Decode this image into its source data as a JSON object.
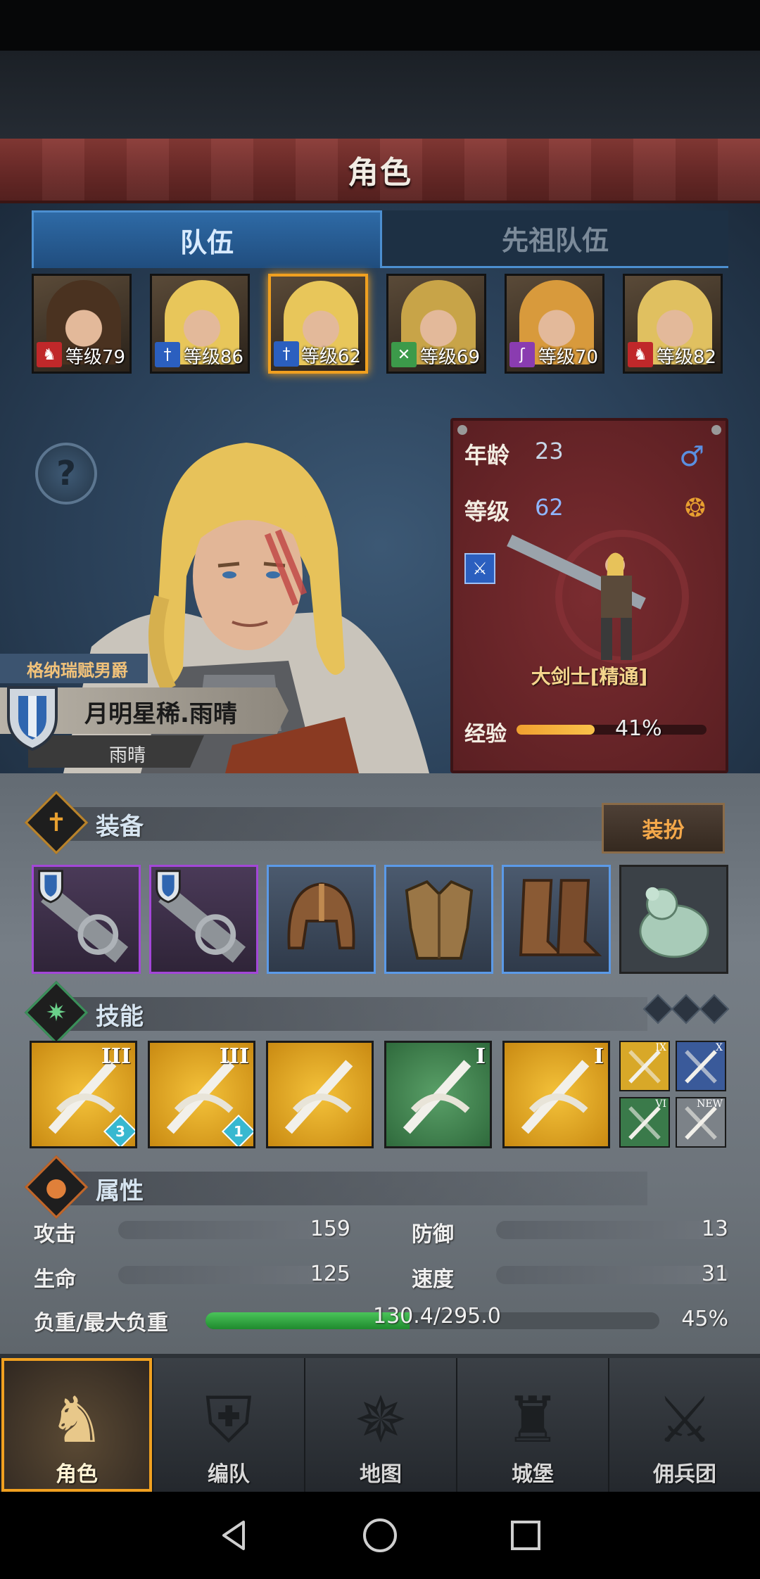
{
  "header": {
    "title": "角色"
  },
  "tabs": [
    {
      "label": "队伍",
      "active": true
    },
    {
      "label": "先祖队伍",
      "active": false
    }
  ],
  "roster": [
    {
      "level_label": "等级79",
      "class_icon": "horse-icon",
      "hair": "#4a3220",
      "icon_color": "#c0282a"
    },
    {
      "level_label": "等级86",
      "class_icon": "sword-icon",
      "hair": "#e8c65a",
      "icon_color": "#2b5fbf"
    },
    {
      "level_label": "等级62",
      "class_icon": "sword-star-icon",
      "hair": "#e8c65a",
      "icon_color": "#2b5fbf",
      "selected": true
    },
    {
      "level_label": "等级69",
      "class_icon": "crossed-swords-icon",
      "hair": "#c8a448",
      "icon_color": "#3c9a4a"
    },
    {
      "level_label": "等级70",
      "class_icon": "staff-icon",
      "hair": "#d89a3c",
      "icon_color": "#8a3cb0"
    },
    {
      "level_label": "等级82",
      "class_icon": "horse-icon",
      "hair": "#e0c060",
      "icon_color": "#c0282a"
    }
  ],
  "character": {
    "title": "格纳瑞赋男爵",
    "name": "月明星稀.雨晴",
    "short_name": "雨晴",
    "age_label": "年龄",
    "age": "23",
    "level_label": "等级",
    "level": "62",
    "class_name": "大剑士[精通]",
    "exp_label": "经验",
    "exp_percent": "41%",
    "exp_value": 0.41
  },
  "equipment": {
    "title": "装备",
    "dress_button": "装扮",
    "slots": [
      {
        "name": "greatsword-slot",
        "rarity": "purple"
      },
      {
        "name": "greatsword-slot",
        "rarity": "purple"
      },
      {
        "name": "helmet-slot",
        "rarity": "blue"
      },
      {
        "name": "armor-slot",
        "rarity": "blue"
      },
      {
        "name": "boots-slot",
        "rarity": "blue"
      },
      {
        "name": "jade-trinket-slot",
        "rarity": "gray"
      }
    ]
  },
  "skills": {
    "title": "技能",
    "list": [
      {
        "name": "whirlwind-skill",
        "color": "gold",
        "tier": "III",
        "badge": "3"
      },
      {
        "name": "sword-strike-skill",
        "color": "gold",
        "tier": "III",
        "badge": "1"
      },
      {
        "name": "sword-guard-skill",
        "color": "gold",
        "tier": "",
        "badge": ""
      },
      {
        "name": "burst-skill",
        "color": "green",
        "tier": "I",
        "badge": ""
      },
      {
        "name": "impact-skill",
        "color": "gold",
        "tier": "I",
        "badge": ""
      }
    ],
    "mini": [
      {
        "name": "mini-skill-1",
        "tier": "IX"
      },
      {
        "name": "mini-skill-2",
        "tier": "X"
      },
      {
        "name": "mini-skill-3",
        "tier": "VI"
      },
      {
        "name": "mini-skill-new",
        "tier": "NEW"
      }
    ]
  },
  "attributes": {
    "title": "属性",
    "attack_label": "攻击",
    "attack": "159",
    "defense_label": "防御",
    "defense": "13",
    "hp_label": "生命",
    "hp": "125",
    "speed_label": "速度",
    "speed": "31",
    "load_label": "负重/最大负重",
    "load": "130.4/295.0",
    "load_percent": "45%",
    "load_value": 0.45
  },
  "nav": [
    {
      "label": "角色",
      "glyph": "♞",
      "active": true
    },
    {
      "label": "编队",
      "glyph": "⛨",
      "active": false
    },
    {
      "label": "地图",
      "glyph": "✵",
      "active": false
    },
    {
      "label": "城堡",
      "glyph": "♜",
      "active": false
    },
    {
      "label": "佣兵团",
      "glyph": "⚔",
      "active": false
    }
  ]
}
